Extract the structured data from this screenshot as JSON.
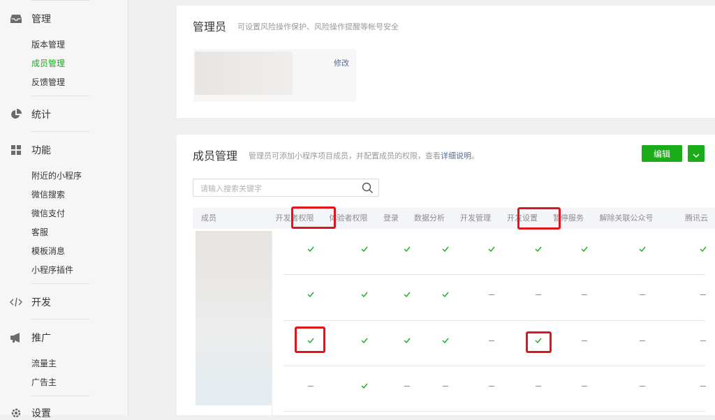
{
  "sidebar": {
    "sections": [
      {
        "id": "manage",
        "label": "管理",
        "icon": "inbox-icon"
      },
      {
        "id": "stats",
        "label": "统计",
        "icon": "pie-chart-icon"
      },
      {
        "id": "features",
        "label": "功能",
        "icon": "grid-icon"
      },
      {
        "id": "dev",
        "label": "开发",
        "icon": "code-icon"
      },
      {
        "id": "promo",
        "label": "推广",
        "icon": "megaphone-icon"
      },
      {
        "id": "settings",
        "label": "设置",
        "icon": "gear-icon"
      }
    ],
    "manage_items": [
      "版本管理",
      "成员管理",
      "反馈管理"
    ],
    "manage_active": "成员管理",
    "feature_items": [
      "附近的小程序",
      "微信搜索",
      "微信支付",
      "客服",
      "模板消息",
      "小程序插件"
    ],
    "promo_items": [
      "流量主",
      "广告主"
    ]
  },
  "admin": {
    "title": "管理员",
    "desc": "可设置风险操作保护、风险操作提醒等帐号安全",
    "modify_label": "修改"
  },
  "members": {
    "title": "成员管理",
    "desc_prefix": "管理员可添加小程序项目成员，并配置成员的权限，查看",
    "desc_link": "详细说明",
    "desc_suffix": "。",
    "edit_label": "编辑",
    "search_placeholder": "请输入搜索关键字",
    "columns": [
      "成员",
      "开发者权限",
      "体验者权限",
      "登录",
      "数据分析",
      "开发管理",
      "开发设置",
      "暂停服务",
      "解除关联公众号",
      "腾讯云"
    ],
    "rows": [
      [
        "check",
        "check",
        "check",
        "check",
        "check",
        "check",
        "check",
        "check",
        "check"
      ],
      [
        "check",
        "check",
        "check",
        "check",
        "dash",
        "dash",
        "dash",
        "dash",
        "dash"
      ],
      [
        "check",
        "check",
        "check",
        "check",
        "dash",
        "check",
        "dash",
        "dash",
        "dash"
      ],
      [
        "dash",
        "check",
        "dash",
        "dash",
        "dash",
        "dash",
        "dash",
        "dash",
        "dash"
      ]
    ]
  },
  "colors": {
    "accent": "#1aad19",
    "highlight": "#e0141b",
    "link": "#576b95"
  }
}
